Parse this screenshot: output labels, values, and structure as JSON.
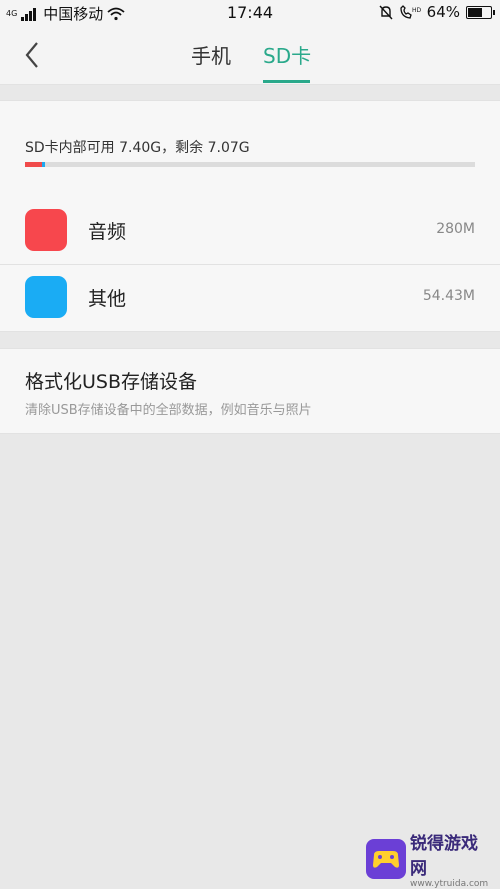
{
  "status_bar": {
    "network": "4G",
    "carrier": "中国移动",
    "time": "17:44",
    "battery": "64%",
    "battery_level": 0.64
  },
  "header": {
    "tabs": [
      {
        "label": "手机",
        "active": false
      },
      {
        "label": "SD卡",
        "active": true
      }
    ]
  },
  "storage": {
    "summary": "SD卡内部可用 7.40G，剩余 7.07G",
    "bar_segments": [
      {
        "name": "音频",
        "fraction": 0.037,
        "color": "#f04b4b"
      },
      {
        "name": "其他",
        "fraction": 0.007,
        "color": "#1ea8f0"
      }
    ]
  },
  "categories": [
    {
      "label": "音频",
      "size": "280M",
      "color": "#f7474d"
    },
    {
      "label": "其他",
      "size": "54.43M",
      "color": "#1aacf4"
    }
  ],
  "format": {
    "title": "格式化USB存储设备",
    "description": "清除USB存储设备中的全部数据，例如音乐与照片"
  },
  "watermark": {
    "name": "锐得游戏网",
    "url": "www.ytruida.com"
  },
  "colors": {
    "accent": "#2aa98b"
  }
}
